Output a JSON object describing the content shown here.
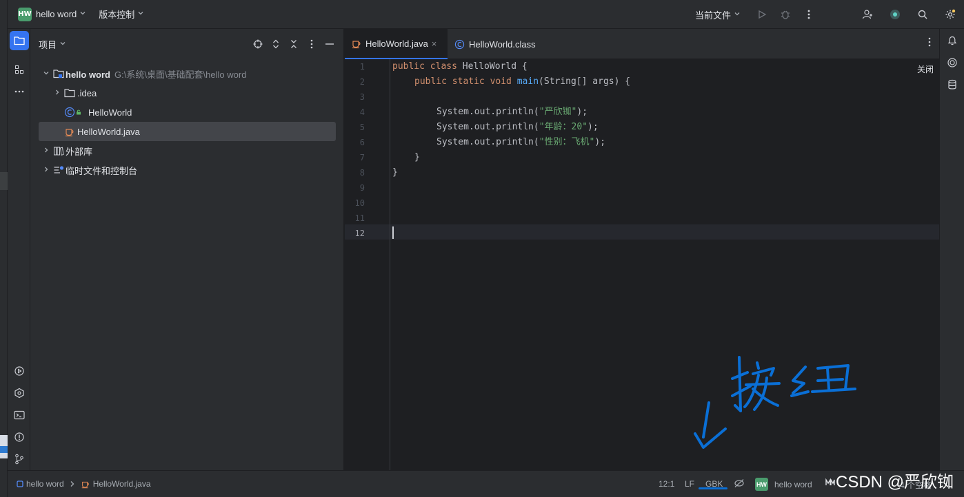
{
  "titlebar": {
    "project_badge": "HW",
    "project_name": "hello word",
    "vcs_label": "版本控制",
    "run_config": "当前文件"
  },
  "project_panel": {
    "title": "项目",
    "tree": [
      {
        "name": "hello word",
        "path": "G:\\系统\\桌面\\基础配套\\hello word",
        "expanded": true
      },
      {
        "name": ".idea",
        "expanded": false
      },
      {
        "name": "HelloWorld"
      },
      {
        "name": "HelloWorld.java",
        "selected": true
      },
      {
        "name": "外部库",
        "expanded": false
      },
      {
        "name": "临时文件和控制台",
        "expanded": false
      }
    ]
  },
  "editor": {
    "tabs": [
      {
        "label": "HelloWorld.java",
        "active": true
      },
      {
        "label": "HelloWorld.class",
        "active": false
      }
    ],
    "close_hint": "关闭",
    "line_numbers": [
      "1",
      "2",
      "3",
      "4",
      "5",
      "6",
      "7",
      "8",
      "9",
      "10",
      "11",
      "12"
    ],
    "current_line": "12",
    "code": {
      "l1_kw": "public class",
      "l1_rest": " HelloWorld {",
      "l2_kw": "public static void",
      "l2_fn": "main",
      "l2_rest": "(String[] args) {",
      "l4_pre": "System.out.println(",
      "l4_str": "\"严欣铷\"",
      "l4_post": ");",
      "l5_pre": "System.out.println(",
      "l5_str": "\"年龄：20\"",
      "l5_post": ");",
      "l6_pre": "System.out.println(",
      "l6_str": "\"性别：飞机\"",
      "l6_post": ");",
      "l7": "}",
      "l8": "}"
    }
  },
  "statusbar": {
    "breadcrumb_project": "hello word",
    "breadcrumb_file": "HelloWorld.java",
    "position": "12:1",
    "line_sep": "LF",
    "encoding": "GBK",
    "project_badge": "HW",
    "project_name": "hello word",
    "indent": "4 个空格"
  },
  "watermark": "CSDN @严欣铷",
  "annotation": {
    "text": "按钮",
    "color": "#0a6fd6"
  },
  "colors": {
    "accent": "#3574f0",
    "badge": "#4a9c6d"
  }
}
